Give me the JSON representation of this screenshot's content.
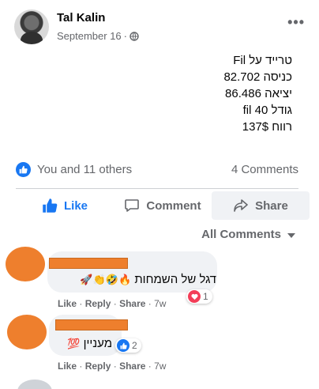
{
  "post": {
    "author": "Tal Kalin",
    "date": "September 16",
    "separator": "·",
    "more_label": "•••",
    "text_lines": [
      "טרייד על Fil",
      "כניסה 82.702",
      "יציאה 86.486",
      "גודל 40 fil",
      "רווח 137$"
    ]
  },
  "reactions": {
    "likes_text": "You and 11 others",
    "comments_text": "4 Comments"
  },
  "actions": {
    "like": "Like",
    "comment": "Comment",
    "share": "Share"
  },
  "comments_sort": "All Comments",
  "comments": [
    {
      "text": "דגל של השמחות",
      "emojis": "🔥🤣👏🚀",
      "like": "Like",
      "reply": "Reply",
      "share": "Share",
      "time": "7w",
      "reaction_count": "1"
    },
    {
      "text": "מעניין",
      "emojis": "💯",
      "like": "Like",
      "reply": "Reply",
      "share": "Share",
      "time": "7w",
      "reaction_count": "2"
    }
  ],
  "colors": {
    "brand_blue": "#1877f2",
    "redaction_orange": "#ee7f2d",
    "heart_red": "#f33e58",
    "muted_text": "#65676b"
  }
}
